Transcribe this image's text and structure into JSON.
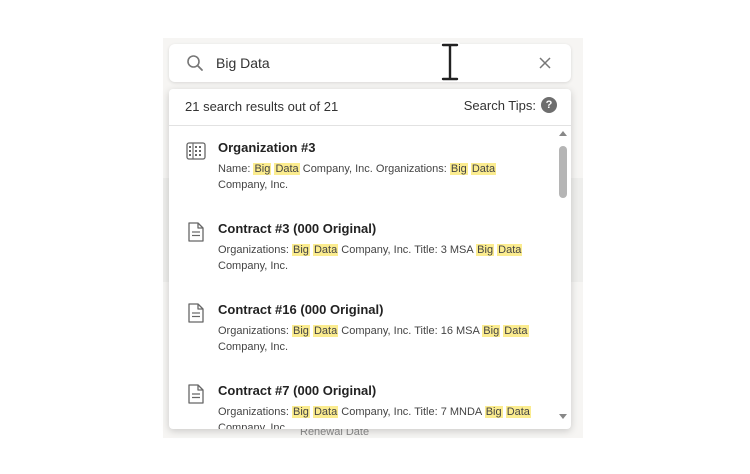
{
  "search": {
    "value": "Big Data",
    "icon": "search-icon",
    "clear_icon": "close-icon"
  },
  "dropdown": {
    "result_count": "21 search results out of 21",
    "tips_label": "Search Tips:",
    "tips_icon": "?"
  },
  "results": [
    {
      "icon": "building-icon",
      "title": "Organization #3",
      "snippet": [
        {
          "t": "Name: "
        },
        {
          "t": "Big",
          "hl": true
        },
        {
          "t": " "
        },
        {
          "t": "Data",
          "hl": true
        },
        {
          "t": " Company, Inc. Organizations: "
        },
        {
          "t": "Big",
          "hl": true
        },
        {
          "t": " "
        },
        {
          "t": "Data",
          "hl": true
        },
        {
          "t": " Company, Inc."
        }
      ]
    },
    {
      "icon": "document-icon",
      "title": "Contract #3 (000 Original)",
      "snippet": [
        {
          "t": "Organizations: "
        },
        {
          "t": "Big",
          "hl": true
        },
        {
          "t": " "
        },
        {
          "t": "Data",
          "hl": true
        },
        {
          "t": " Company, Inc. Title: 3 MSA "
        },
        {
          "t": "Big",
          "hl": true
        },
        {
          "t": " "
        },
        {
          "t": "Data",
          "hl": true
        },
        {
          "t": " Company, Inc."
        }
      ]
    },
    {
      "icon": "document-icon",
      "title": "Contract #16 (000 Original)",
      "snippet": [
        {
          "t": "Organizations: "
        },
        {
          "t": "Big",
          "hl": true
        },
        {
          "t": " "
        },
        {
          "t": "Data",
          "hl": true
        },
        {
          "t": " Company, Inc. Title: 16 MSA "
        },
        {
          "t": "Big",
          "hl": true
        },
        {
          "t": " "
        },
        {
          "t": "Data",
          "hl": true
        },
        {
          "t": " Company, Inc."
        }
      ]
    },
    {
      "icon": "document-icon",
      "title": "Contract #7 (000 Original)",
      "snippet": [
        {
          "t": "Organizations: "
        },
        {
          "t": "Big",
          "hl": true
        },
        {
          "t": " "
        },
        {
          "t": "Data",
          "hl": true
        },
        {
          "t": " Company, Inc. Title: 7 MNDA "
        },
        {
          "t": "Big",
          "hl": true
        },
        {
          "t": " "
        },
        {
          "t": "Data",
          "hl": true
        },
        {
          "t": " Company, Inc."
        }
      ]
    }
  ],
  "background": {
    "label": "Renewal Date"
  },
  "colors": {
    "highlight": "#fbec8f",
    "help_icon": "#6e6e6e"
  }
}
